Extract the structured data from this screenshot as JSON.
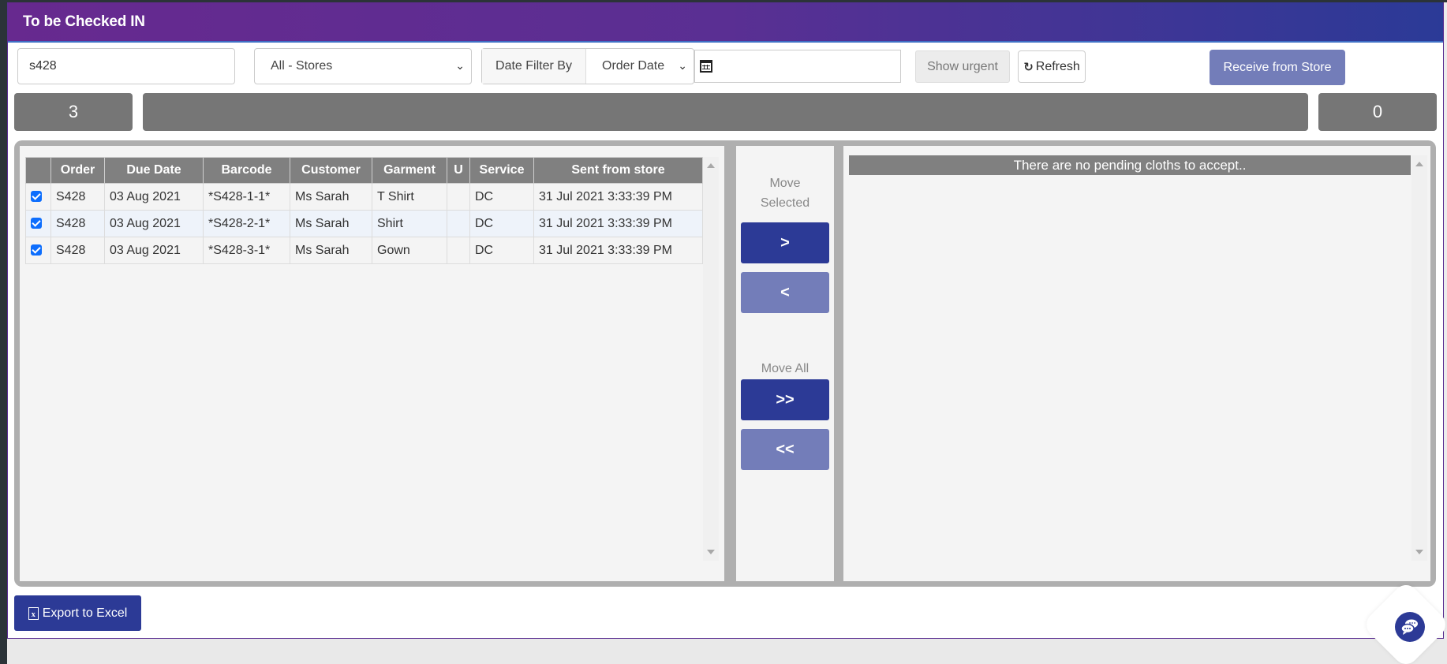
{
  "header": {
    "title": "To be Checked IN"
  },
  "filters": {
    "search_value": "s428",
    "store_select": "All - Stores",
    "date_filter_label": "Date Filter By",
    "date_filter_select": "Order Date",
    "date_range_value": "",
    "show_urgent_label": "Show urgent",
    "refresh_label": "Refresh",
    "receive_label": "Receive from Store"
  },
  "counters": {
    "left_count": "3",
    "right_count": "0"
  },
  "pending_table": {
    "columns": [
      "",
      "Order",
      "Due Date",
      "Barcode",
      "Customer",
      "Garment",
      "U",
      "Service",
      "Sent from store"
    ],
    "rows": [
      {
        "checked": true,
        "order": "S428",
        "due_date": "03 Aug 2021",
        "barcode": "*S428-1-1*",
        "customer": "Ms Sarah",
        "garment": "T Shirt",
        "urgent": "",
        "service": "DC",
        "sent": "31 Jul 2021 3:33:39 PM"
      },
      {
        "checked": true,
        "order": "S428",
        "due_date": "03 Aug 2021",
        "barcode": "*S428-2-1*",
        "customer": "Ms Sarah",
        "garment": "Shirt",
        "urgent": "",
        "service": "DC",
        "sent": "31 Jul 2021 3:33:39 PM"
      },
      {
        "checked": true,
        "order": "S428",
        "due_date": "03 Aug 2021",
        "barcode": "*S428-3-1*",
        "customer": "Ms Sarah",
        "garment": "Gown",
        "urgent": "",
        "service": "DC",
        "sent": "31 Jul 2021 3:33:39 PM"
      }
    ]
  },
  "move_controls": {
    "move_selected_label": "Move Selected",
    "move_selected_right": ">",
    "move_selected_left": "<",
    "move_all_label": "Move All",
    "move_all_right": ">>",
    "move_all_left": "<<"
  },
  "accepted_panel": {
    "empty_message": "There are no pending cloths to accept.."
  },
  "footer": {
    "export_label": "Export to Excel"
  },
  "icons": {
    "calendar": "calendar-icon",
    "refresh": "refresh-icon",
    "excel": "excel-file-icon",
    "chat": "chat-bubbles-icon"
  },
  "colors": {
    "header_gradient_start": "#67298f",
    "header_gradient_end": "#2b3a97",
    "primary_button": "#2c3a96",
    "secondary_button": "#737db9",
    "table_header": "#808080",
    "counter_bg": "#767676"
  }
}
